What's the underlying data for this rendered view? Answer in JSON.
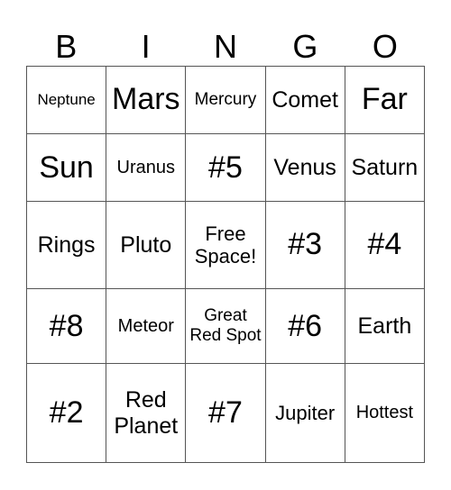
{
  "header": [
    "B",
    "I",
    "N",
    "G",
    "O"
  ],
  "grid": [
    [
      {
        "t": "Neptune",
        "s": "s17"
      },
      {
        "t": "Mars",
        "s": "s36"
      },
      {
        "t": "Mercury",
        "s": "s19"
      },
      {
        "t": "Comet",
        "s": "s25"
      },
      {
        "t": "Far",
        "s": "s36"
      }
    ],
    [
      {
        "t": "Sun",
        "s": "s36"
      },
      {
        "t": "Uranus",
        "s": "s20"
      },
      {
        "t": "#5",
        "s": "s36"
      },
      {
        "t": "Venus",
        "s": "s25"
      },
      {
        "t": "Saturn",
        "s": "s25"
      }
    ],
    [
      {
        "t": "Rings",
        "s": "s25"
      },
      {
        "t": "Pluto",
        "s": "s25"
      },
      {
        "t": "Free Space!",
        "s": "s22"
      },
      {
        "t": "#3",
        "s": "s36"
      },
      {
        "t": "#4",
        "s": "s36"
      }
    ],
    [
      {
        "t": "#8",
        "s": "s36"
      },
      {
        "t": "Meteor",
        "s": "s20"
      },
      {
        "t": "Great Red Spot",
        "s": "s19"
      },
      {
        "t": "#6",
        "s": "s36"
      },
      {
        "t": "Earth",
        "s": "s25"
      }
    ],
    [
      {
        "t": "#2",
        "s": "s36"
      },
      {
        "t": "Red Planet",
        "s": "s25"
      },
      {
        "t": "#7",
        "s": "s36"
      },
      {
        "t": "Jupiter",
        "s": "s22"
      },
      {
        "t": "Hottest",
        "s": "s20"
      }
    ]
  ]
}
